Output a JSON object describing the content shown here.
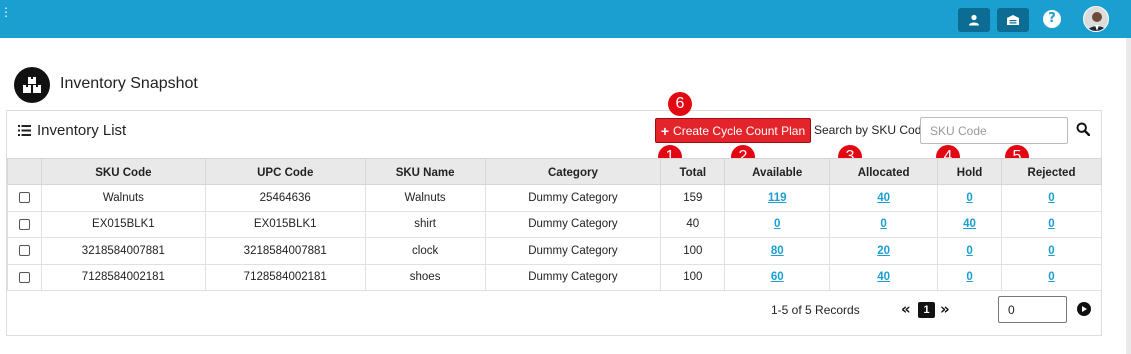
{
  "header": {
    "icons": [
      "user-icon",
      "store-icon",
      "help-icon",
      "avatar"
    ],
    "accent_color": "#1a9fd0"
  },
  "page": {
    "title": "Inventory Snapshot",
    "icon": "boxes-icon"
  },
  "toolbar": {
    "list_title": "Inventory List",
    "create_label": "Create Cycle Count Plan",
    "create_color": "#e3242b",
    "search_label": "Search by SKU Code:",
    "search_placeholder": "SKU Code"
  },
  "callouts": [
    "6",
    "1",
    "2",
    "3",
    "4",
    "5"
  ],
  "table": {
    "columns": [
      "SKU Code",
      "UPC Code",
      "SKU Name",
      "Category",
      "Total",
      "Available",
      "Allocated",
      "Hold",
      "Rejected"
    ],
    "rows": [
      {
        "sku": "Walnuts",
        "upc": "25464636",
        "name": "Walnuts",
        "category": "Dummy Category",
        "total": "159",
        "available": "119",
        "allocated": "40",
        "hold": "0",
        "rejected": "0"
      },
      {
        "sku": "EX015BLK1",
        "upc": "EX015BLK1",
        "name": "shirt",
        "category": "Dummy Category",
        "total": "40",
        "available": "0",
        "allocated": "0",
        "hold": "40",
        "rejected": "0"
      },
      {
        "sku": "3218584007881",
        "upc": "3218584007881",
        "name": "clock",
        "category": "Dummy Category",
        "total": "100",
        "available": "80",
        "allocated": "20",
        "hold": "0",
        "rejected": "0"
      },
      {
        "sku": "7128584002181",
        "upc": "7128584002181",
        "name": "shoes",
        "category": "Dummy Category",
        "total": "100",
        "available": "60",
        "allocated": "40",
        "hold": "0",
        "rejected": "0"
      }
    ]
  },
  "pagination": {
    "records_text": "1-5 of 5 Records",
    "prev": "«",
    "current_page": "1",
    "next": "»",
    "page_input_value": "0"
  }
}
